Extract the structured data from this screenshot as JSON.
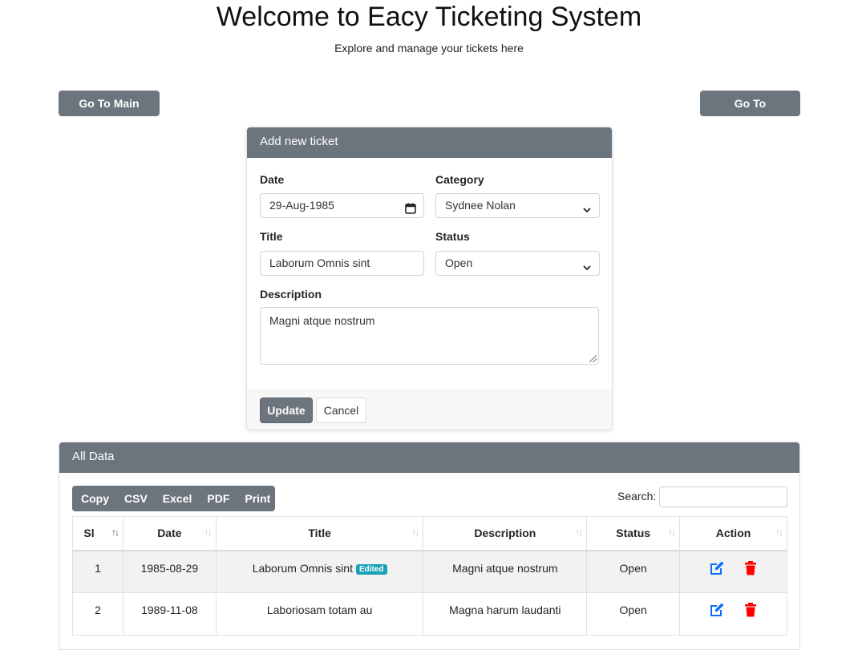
{
  "header": {
    "title": "Welcome to Eacy Ticketing System",
    "subtitle": "Explore and manage your tickets here"
  },
  "nav": {
    "main_index_label": "Go To Main Index",
    "categories_label": "Go To Categories"
  },
  "form": {
    "title": "Add new ticket",
    "date_label": "Date",
    "date_value": "29-Aug-1985",
    "category_label": "Category",
    "category_value": "Sydnee Nolan",
    "title_label": "Title",
    "title_value": "Laborum Omnis sint",
    "status_label": "Status",
    "status_value": "Open",
    "description_label": "Description",
    "description_value": "Magni atque nostrum",
    "update_label": "Update",
    "cancel_label": "Cancel"
  },
  "data_panel": {
    "title": "All Data",
    "export_buttons": [
      "Copy",
      "CSV",
      "Excel",
      "PDF",
      "Print"
    ],
    "search_label": "Search:",
    "columns": [
      "Sl",
      "Date",
      "Title",
      "Description",
      "Status",
      "Action"
    ],
    "rows": [
      {
        "sl": "1",
        "date": "1985-08-29",
        "title": "Laborum Omnis sint",
        "badge": "Edited",
        "description": "Magni atque nostrum",
        "status": "Open"
      },
      {
        "sl": "2",
        "date": "1989-11-08",
        "title": "Laboriosam totam au",
        "badge": "",
        "description": "Magna harum laudanti",
        "status": "Open"
      }
    ]
  },
  "icons": {
    "calendar": "calendar-icon",
    "dropdown": "chevron-down-icon",
    "edit": "edit-icon",
    "delete": "trash-icon",
    "sort": "sort-icon"
  },
  "colors": {
    "header_gray": "#6c757d",
    "edit_blue": "#0d6efd",
    "delete_red": "#ff0000",
    "badge_teal": "#17a2b8"
  }
}
